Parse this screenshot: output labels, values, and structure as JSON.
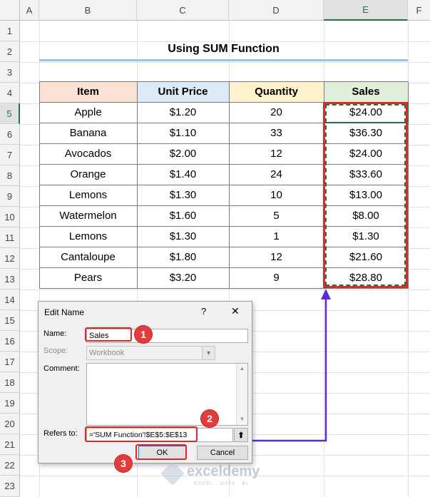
{
  "columns": [
    "A",
    "B",
    "C",
    "D",
    "E",
    "F"
  ],
  "selected_column": "E",
  "selected_row": "5",
  "rows": [
    "1",
    "2",
    "3",
    "4",
    "5",
    "6",
    "7",
    "8",
    "9",
    "10",
    "11",
    "12",
    "13",
    "14",
    "15",
    "16",
    "17",
    "18",
    "19",
    "20",
    "21",
    "22",
    "23"
  ],
  "title": "Using SUM Function",
  "table": {
    "headers": [
      "Item",
      "Unit Price",
      "Quantity",
      "Sales"
    ],
    "header_colors": [
      "#fbe2d5",
      "#dcebf7",
      "#fff2cc",
      "#e2efda"
    ],
    "rows": [
      [
        "Apple",
        "$1.20",
        "20",
        "$24.00"
      ],
      [
        "Banana",
        "$1.10",
        "33",
        "$36.30"
      ],
      [
        "Avocados",
        "$2.00",
        "12",
        "$24.00"
      ],
      [
        "Orange",
        "$1.40",
        "24",
        "$33.60"
      ],
      [
        "Lemons",
        "$1.30",
        "10",
        "$13.00"
      ],
      [
        "Watermelon",
        "$1.60",
        "5",
        "$8.00"
      ],
      [
        "Lemons",
        "$1.30",
        "1",
        "$1.30"
      ],
      [
        "Cantaloupe",
        "$1.80",
        "12",
        "$21.60"
      ],
      [
        "Pears",
        "$3.20",
        "9",
        "$28.80"
      ]
    ]
  },
  "dialog": {
    "title": "Edit Name",
    "help": "?",
    "close": "✕",
    "name_label": "Name:",
    "name_value": "Sales",
    "scope_label": "Scope:",
    "scope_value": "Workbook",
    "comment_label": "Comment:",
    "refers_label": "Refers to:",
    "refers_value": "='SUM Function'!$E$5:$E$13",
    "ok_label": "OK",
    "cancel_label": "Cancel"
  },
  "steps": [
    "1",
    "2",
    "3"
  ],
  "watermark": {
    "brand": "exceldemy",
    "tagline": "EXCEL · DATA · BI"
  },
  "colors": {
    "accent_red": "#e0282a",
    "arrow": "#5b2bd6",
    "excel_green": "#217346"
  }
}
